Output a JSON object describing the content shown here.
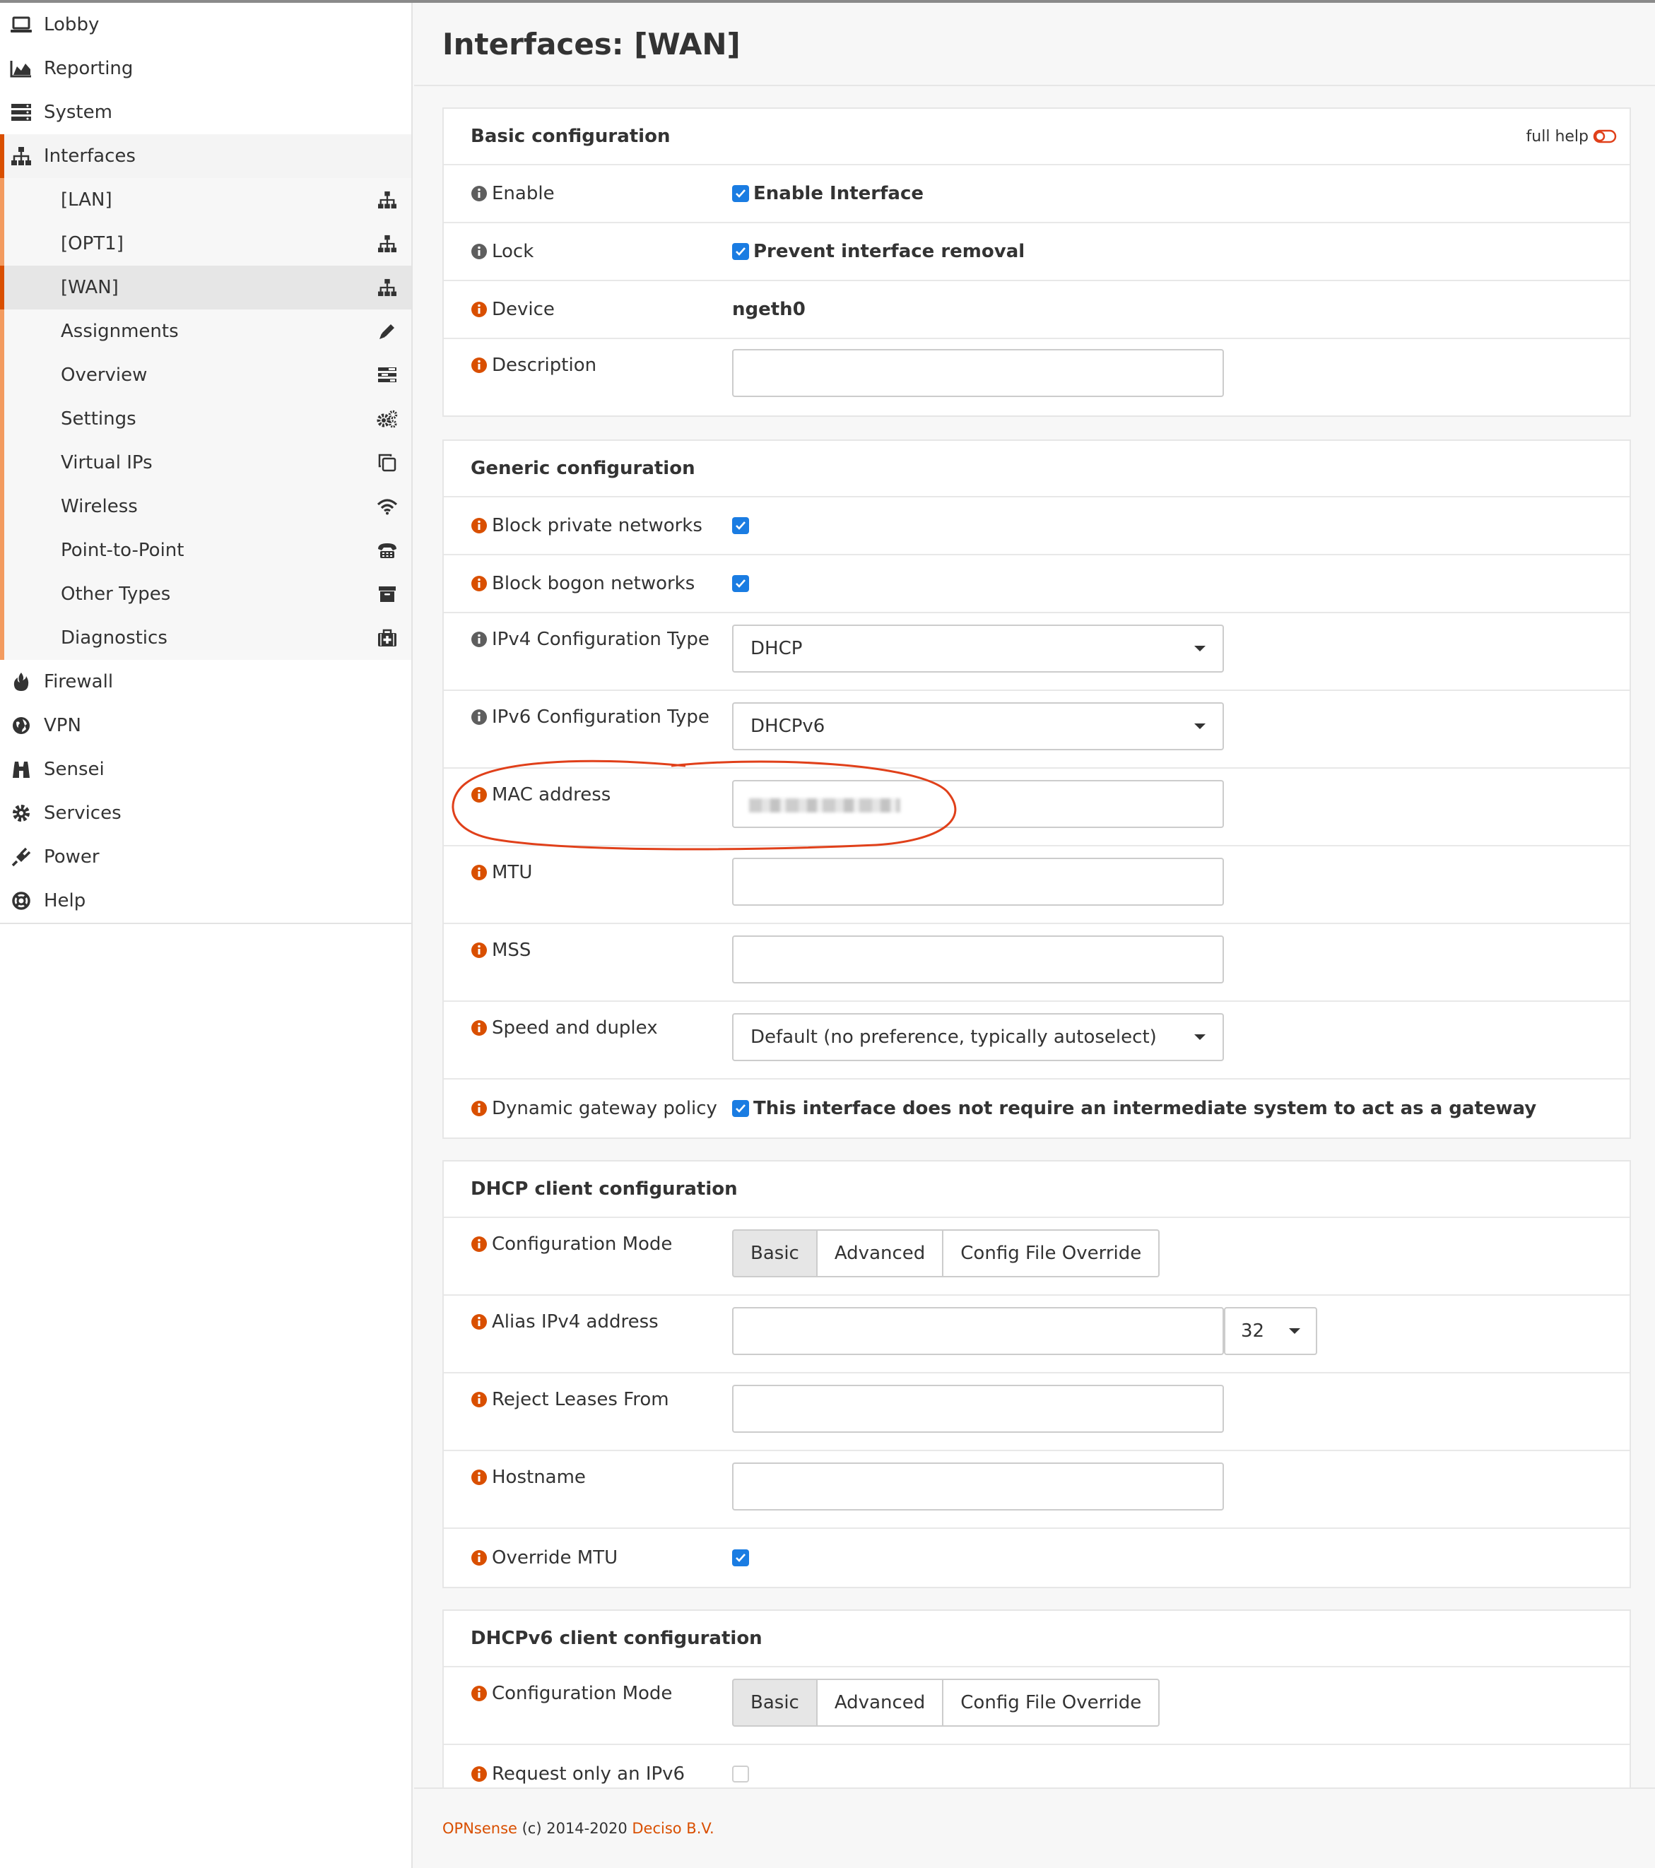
{
  "sidebar": {
    "items_top": [
      {
        "label": "Lobby",
        "icon": "laptop-icon"
      },
      {
        "label": "Reporting",
        "icon": "area-chart-icon"
      },
      {
        "label": "System",
        "icon": "server-icon"
      },
      {
        "label": "Interfaces",
        "icon": "sitemap-icon"
      }
    ],
    "sub_items": [
      {
        "label": "[LAN]",
        "icon": "sitemap-icon"
      },
      {
        "label": "[OPT1]",
        "icon": "sitemap-icon"
      },
      {
        "label": "[WAN]",
        "icon": "sitemap-icon"
      },
      {
        "label": "Assignments",
        "icon": "pencil-icon"
      },
      {
        "label": "Overview",
        "icon": "tasks-icon"
      },
      {
        "label": "Settings",
        "icon": "cogs-icon"
      },
      {
        "label": "Virtual IPs",
        "icon": "clone-icon"
      },
      {
        "label": "Wireless",
        "icon": "wifi-icon"
      },
      {
        "label": "Point-to-Point",
        "icon": "fax-icon"
      },
      {
        "label": "Other Types",
        "icon": "archive-icon"
      },
      {
        "label": "Diagnostics",
        "icon": "medkit-icon"
      }
    ],
    "items_bottom": [
      {
        "label": "Firewall",
        "icon": "fire-icon"
      },
      {
        "label": "VPN",
        "icon": "globe-icon"
      },
      {
        "label": "Sensei",
        "icon": "binoculars-icon"
      },
      {
        "label": "Services",
        "icon": "cog-icon"
      },
      {
        "label": "Power",
        "icon": "plug-icon"
      },
      {
        "label": "Help",
        "icon": "life-ring-icon"
      }
    ]
  },
  "page": {
    "title": "Interfaces: [WAN]"
  },
  "basic": {
    "header": "Basic configuration",
    "full_help": "full help",
    "enable_label": "Enable",
    "enable_value": "Enable Interface",
    "lock_label": "Lock",
    "lock_value": "Prevent interface removal",
    "device_label": "Device",
    "device_value": "ngeth0",
    "description_label": "Description",
    "description_value": ""
  },
  "generic": {
    "header": "Generic configuration",
    "block_private_label": "Block private networks",
    "block_bogon_label": "Block bogon networks",
    "ipv4_type_label": "IPv4 Configuration Type",
    "ipv4_type_value": "DHCP",
    "ipv6_type_label": "IPv6 Configuration Type",
    "ipv6_type_value": "DHCPv6",
    "mac_label": "MAC address",
    "mtu_label": "MTU",
    "mss_label": "MSS",
    "speed_label": "Speed and duplex",
    "speed_value": "Default (no preference, typically autoselect)",
    "gateway_label": "Dynamic gateway policy",
    "gateway_value": "This interface does not require an intermediate system to act as a gateway"
  },
  "dhcp": {
    "header": "DHCP client configuration",
    "mode_label": "Configuration Mode",
    "modes": [
      "Basic",
      "Advanced",
      "Config File Override"
    ],
    "alias_label": "Alias IPv4 address",
    "alias_prefix": "32",
    "reject_label": "Reject Leases From",
    "hostname_label": "Hostname",
    "override_mtu_label": "Override MTU"
  },
  "dhcp6": {
    "header": "DHCPv6 client configuration",
    "mode_label": "Configuration Mode",
    "modes": [
      "Basic",
      "Advanced",
      "Config File Override"
    ],
    "request_ipv6_label": "Request only an IPv6"
  },
  "footer": {
    "brand": "OPNsense",
    "copyright": " (c) 2014-2020 ",
    "company": "Deciso B.V."
  },
  "colors": {
    "accent": "#d94f00",
    "accent_light": "#f39b5f",
    "checkbox": "#1a7ce2",
    "annotation": "#e0401a"
  }
}
